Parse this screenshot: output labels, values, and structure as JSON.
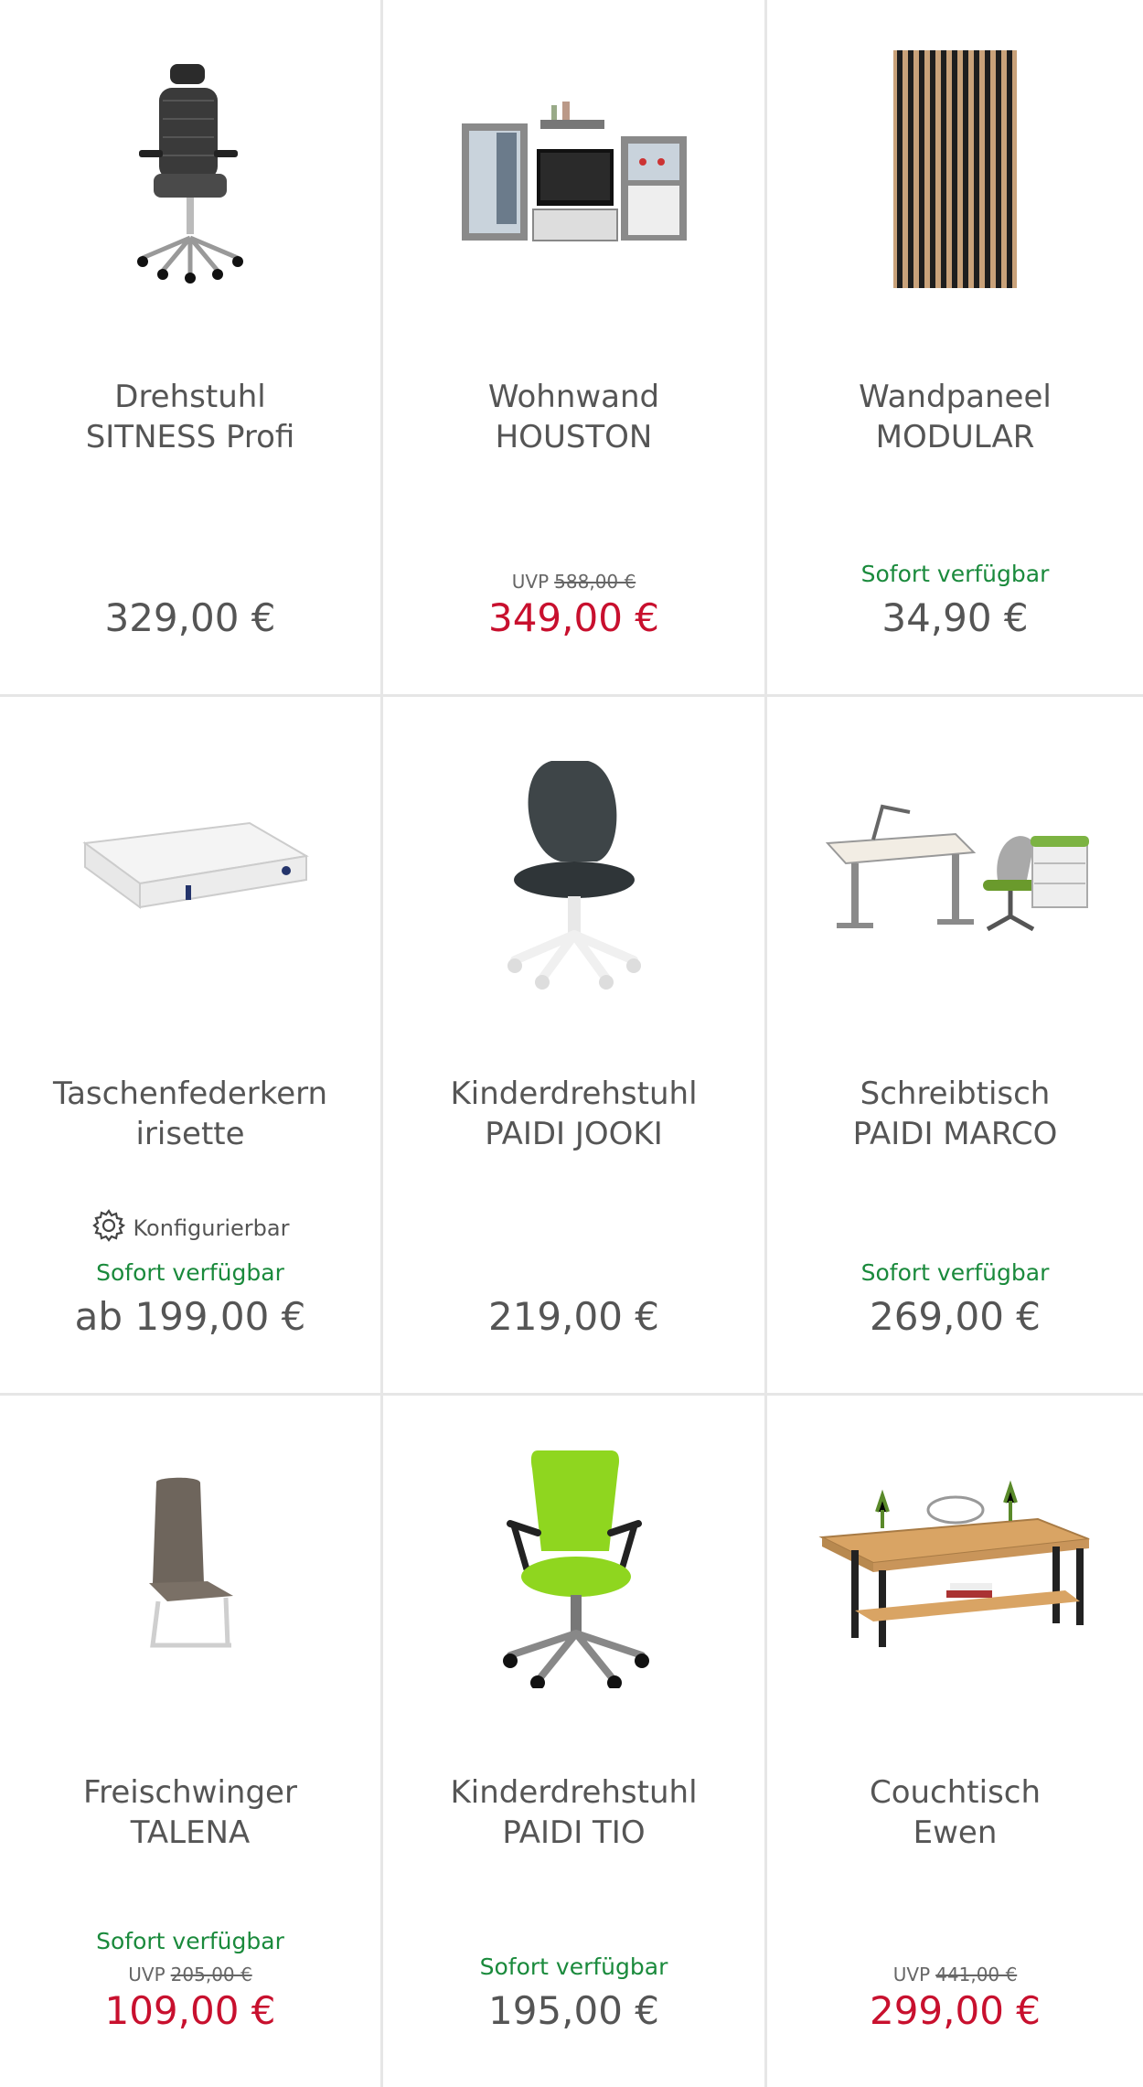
{
  "colors": {
    "availability": "#1a8a3c",
    "sale_price": "#c8102e",
    "text": "#555555",
    "border": "#e6e6e6"
  },
  "products": [
    {
      "name_line1": "Drehstuhl",
      "name_line2": "SITNESS Profi",
      "icon": "office-chair-image",
      "availability": "",
      "uvp_label": "",
      "uvp_price": "",
      "price": "329,00 €",
      "sale": false,
      "configurable": ""
    },
    {
      "name_line1": "Wohnwand",
      "name_line2": "HOUSTON",
      "icon": "wall-unit-image",
      "availability": "",
      "uvp_label": "UVP",
      "uvp_price": "588,00 €",
      "price": "349,00 €",
      "sale": true,
      "configurable": ""
    },
    {
      "name_line1": "Wandpaneel",
      "name_line2": "MODULAR",
      "icon": "wall-panel-image",
      "availability": "Sofort verfügbar",
      "uvp_label": "",
      "uvp_price": "",
      "price": "34,90 €",
      "sale": false,
      "configurable": ""
    },
    {
      "name_line1": "Taschenfederkern",
      "name_line2": "irisette",
      "icon": "mattress-image",
      "availability": "Sofort verfügbar",
      "uvp_label": "",
      "uvp_price": "",
      "price": "ab 199,00 €",
      "sale": false,
      "configurable": "Konfigurierbar"
    },
    {
      "name_line1": "Kinderdrehstuhl",
      "name_line2": "PAIDI JOOKI",
      "icon": "kids-chair-image",
      "availability": "",
      "uvp_label": "",
      "uvp_price": "",
      "price": "219,00 €",
      "sale": false,
      "configurable": ""
    },
    {
      "name_line1": "Schreibtisch",
      "name_line2": "PAIDI MARCO",
      "icon": "desk-set-image",
      "availability": "Sofort verfügbar",
      "uvp_label": "",
      "uvp_price": "",
      "price": "269,00 €",
      "sale": false,
      "configurable": ""
    },
    {
      "name_line1": "Freischwinger",
      "name_line2": "TALENA",
      "icon": "cantilever-chair-image",
      "availability": "Sofort verfügbar",
      "uvp_label": "UVP",
      "uvp_price": "205,00 €",
      "price": "109,00 €",
      "sale": true,
      "configurable": ""
    },
    {
      "name_line1": "Kinderdrehstuhl",
      "name_line2": "PAIDI TIO",
      "icon": "green-swivel-chair-image",
      "availability": "Sofort verfügbar",
      "uvp_label": "",
      "uvp_price": "",
      "price": "195,00 €",
      "sale": false,
      "configurable": ""
    },
    {
      "name_line1": "Couchtisch",
      "name_line2": "Ewen",
      "icon": "coffee-table-image",
      "availability": "",
      "uvp_label": "UVP",
      "uvp_price": "441,00 €",
      "price": "299,00 €",
      "sale": true,
      "configurable": ""
    }
  ]
}
